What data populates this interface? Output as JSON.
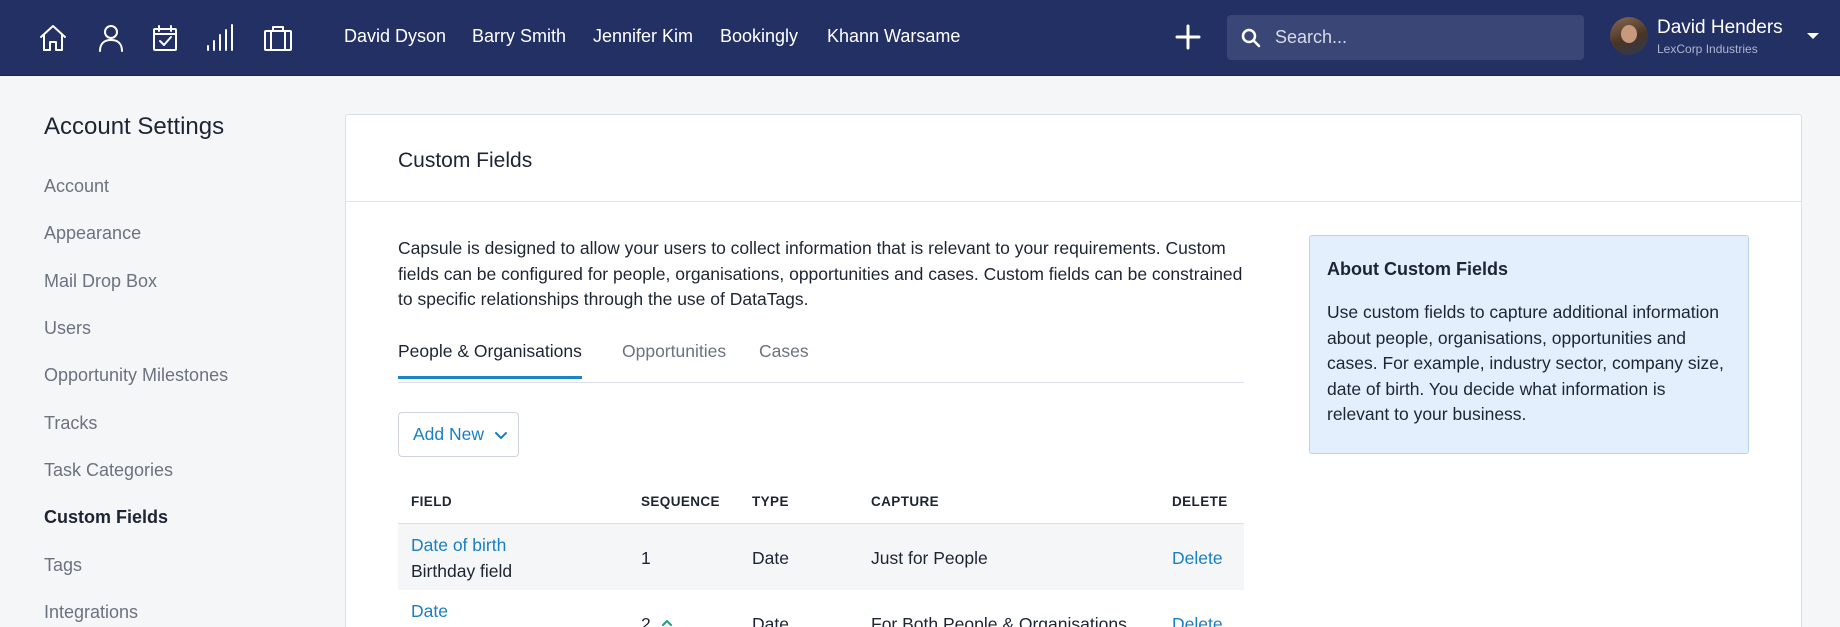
{
  "topnav": {
    "icons": [
      "home-icon",
      "person-icon",
      "calendar-check-icon",
      "signal-bars-icon",
      "briefcase-icon"
    ],
    "recent": [
      "David Dyson",
      "Barry Smith",
      "Jennifer Kim",
      "Bookingly",
      "Khann Warsame"
    ],
    "search_placeholder": "Search...",
    "user": {
      "name": "David Henders",
      "org": "LexCorp Industries"
    },
    "colors": {
      "bar": "#233064",
      "search_bg": "#3a4676"
    }
  },
  "sidebar": {
    "title": "Account Settings",
    "items": [
      {
        "label": "Account"
      },
      {
        "label": "Appearance"
      },
      {
        "label": "Mail Drop Box"
      },
      {
        "label": "Users"
      },
      {
        "label": "Opportunity Milestones"
      },
      {
        "label": "Tracks"
      },
      {
        "label": "Task Categories"
      },
      {
        "label": "Custom Fields",
        "active": true
      },
      {
        "label": "Tags"
      },
      {
        "label": "Integrations"
      }
    ]
  },
  "main": {
    "title": "Custom Fields",
    "intro": "Capsule is designed to allow your users to collect information that is relevant to your requirements. Custom fields can be configured for people, organisations, opportunities and cases. Custom fields can be constrained to specific relationships through the use of DataTags.",
    "tabs": [
      {
        "label": "People & Organisations",
        "active": true
      },
      {
        "label": "Opportunities"
      },
      {
        "label": "Cases"
      }
    ],
    "add_new": "Add New",
    "table": {
      "headers": [
        "FIELD",
        "SEQUENCE",
        "TYPE",
        "CAPTURE",
        "DELETE"
      ],
      "rows": [
        {
          "field": "Date of birth",
          "subtitle": "Birthday field",
          "sequence": "1",
          "type": "Date",
          "capture": "Just for People",
          "delete": "Delete"
        },
        {
          "field": "Date",
          "subtitle": "",
          "sequence": "2",
          "type": "Date",
          "capture": "For Both People & Organisations",
          "delete": "Delete"
        }
      ]
    },
    "about": {
      "title": "About Custom Fields",
      "body": "Use custom fields to capture additional information about people, organisations, opportunities and cases. For example, industry sector, company size, date of birth. You decide what information is relevant to your business."
    },
    "colors": {
      "accent": "#1a84c7",
      "link": "#1a7fc1",
      "about_bg": "#e4effd"
    }
  }
}
